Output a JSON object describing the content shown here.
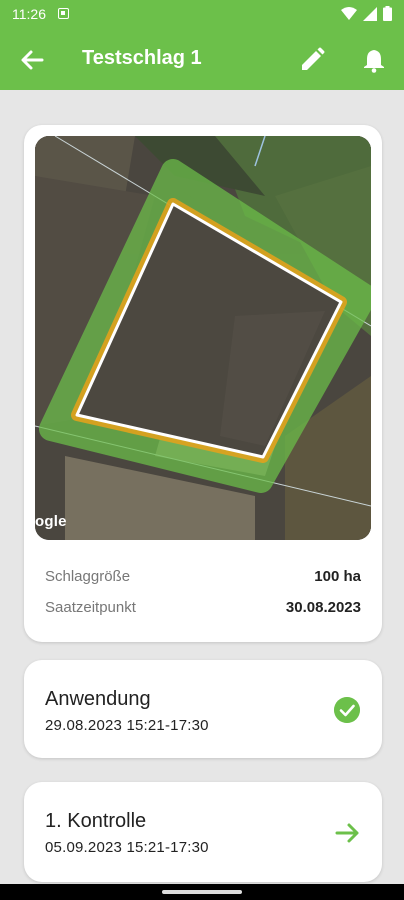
{
  "status_bar": {
    "time": "11:26",
    "icons": [
      "notification-icon",
      "wifi-icon",
      "cellular-icon",
      "battery-icon"
    ]
  },
  "app_bar": {
    "title": "Testschlag 1",
    "icons": [
      "back-arrow-icon",
      "edit-pencil-icon",
      "bell-icon"
    ]
  },
  "field": {
    "map_attribution": "ogle",
    "info": [
      {
        "label": "Schlaggröße",
        "value": "100 ha"
      },
      {
        "label": "Saatzeitpunkt",
        "value": "30.08.2023"
      }
    ]
  },
  "application": {
    "title": "Anwendung",
    "datetime": "29.08.2023   15:21-17:30",
    "status_icon": "check-circle-icon"
  },
  "control": {
    "title": "1. Kontrolle",
    "datetime": "05.09.2023   15:21-17:30",
    "action_icon": "arrow-right-icon"
  },
  "colors": {
    "primary": "#6cc04a",
    "buffer_outer": "#6cc04a",
    "buffer_inner": "#e8a21a"
  }
}
